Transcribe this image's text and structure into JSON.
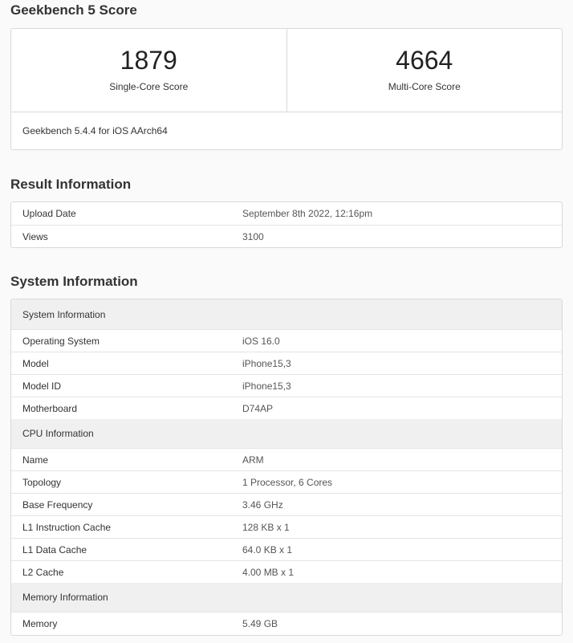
{
  "score_section": {
    "title": "Geekbench 5 Score",
    "single_core": {
      "value": "1879",
      "label": "Single-Core Score"
    },
    "multi_core": {
      "value": "4664",
      "label": "Multi-Core Score"
    },
    "version": "Geekbench 5.4.4 for iOS AArch64"
  },
  "result_section": {
    "title": "Result Information",
    "rows": [
      {
        "label": "Upload Date",
        "value": "September 8th 2022, 12:16pm"
      },
      {
        "label": "Views",
        "value": "3100"
      }
    ]
  },
  "system_section": {
    "title": "System Information",
    "groups": [
      {
        "header": "System Information",
        "rows": [
          {
            "label": "Operating System",
            "value": "iOS 16.0"
          },
          {
            "label": "Model",
            "value": "iPhone15,3"
          },
          {
            "label": "Model ID",
            "value": "iPhone15,3"
          },
          {
            "label": "Motherboard",
            "value": "D74AP"
          }
        ]
      },
      {
        "header": "CPU Information",
        "rows": [
          {
            "label": "Name",
            "value": "ARM"
          },
          {
            "label": "Topology",
            "value": "1 Processor, 6 Cores"
          },
          {
            "label": "Base Frequency",
            "value": "3.46 GHz"
          },
          {
            "label": "L1 Instruction Cache",
            "value": "128 KB x 1"
          },
          {
            "label": "L1 Data Cache",
            "value": "64.0 KB x 1"
          },
          {
            "label": "L2 Cache",
            "value": "4.00 MB x 1"
          }
        ]
      },
      {
        "header": "Memory Information",
        "rows": [
          {
            "label": "Memory",
            "value": "5.49 GB"
          }
        ]
      }
    ]
  }
}
